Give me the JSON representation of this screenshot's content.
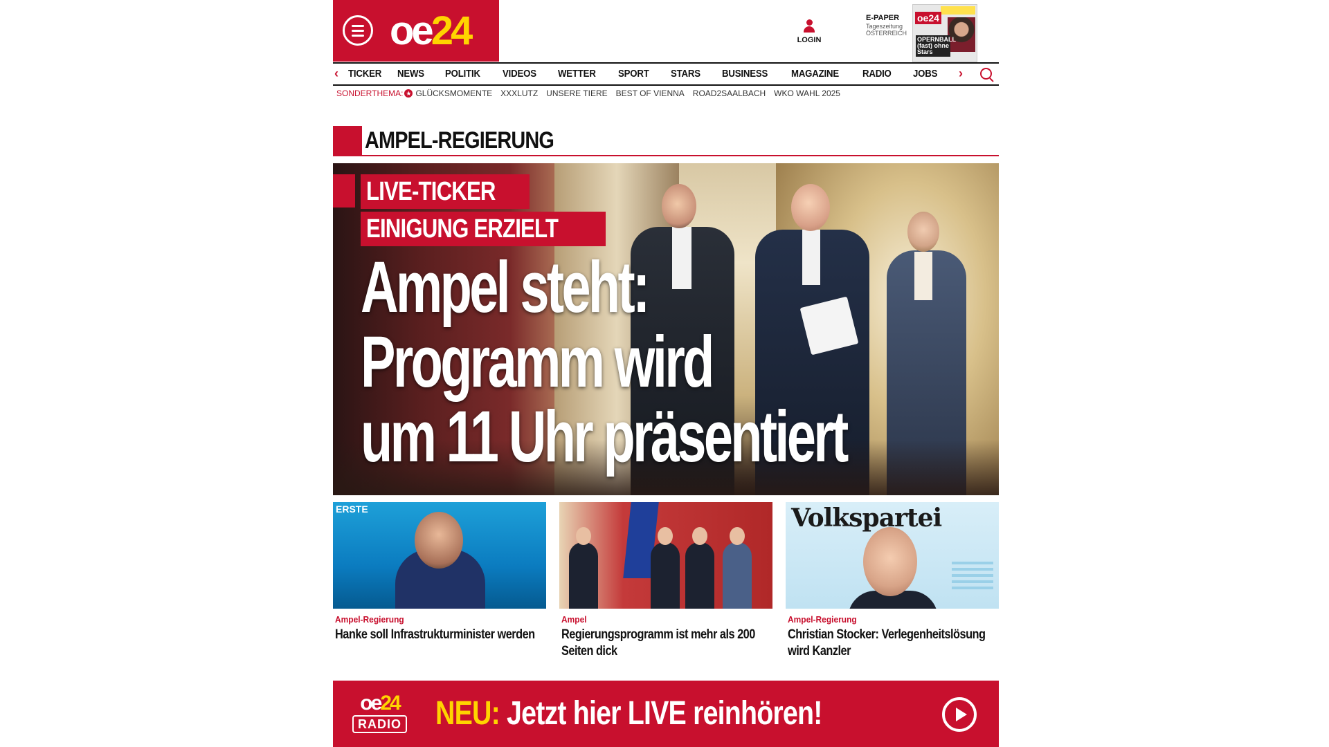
{
  "header": {
    "logo": {
      "part1": "oe",
      "part2": "24"
    },
    "login_label": "LOGIN",
    "epaper": {
      "title": "E-PAPER",
      "line1": "Tageszeitung",
      "line2": "ÖSTERREICH"
    },
    "cover_thumb": {
      "logo": "oe24",
      "headline": "OPERNBALL (fast) ohne Stars"
    }
  },
  "nav": {
    "items": [
      "TICKER",
      "NEWS",
      "POLITIK",
      "VIDEOS",
      "WETTER",
      "SPORT",
      "STARS",
      "BUSINESS",
      "MAGAZINE",
      "RADIO",
      "JOBS"
    ],
    "prev_icon": "chevron-left-icon",
    "next_icon": "chevron-right-icon",
    "search_icon": "search-icon"
  },
  "subnav": {
    "label": "SONDERTHEMA:",
    "items": [
      "GLÜCKSMOMENTE",
      "XXXLUTZ",
      "UNSERE TIERE",
      "BEST OF VIENNA",
      "ROAD2SAALBACH",
      "WKO WAHL 2025"
    ]
  },
  "section": {
    "title": "AMPEL-REGIERUNG"
  },
  "hero": {
    "kicker1": "LIVE-TICKER",
    "kicker2": "EINIGUNG ERZIELT",
    "headline_lines": [
      "Ampel steht:",
      "Programm wird",
      "um 11 Uhr präsentiert"
    ]
  },
  "cards": [
    {
      "category": "Ampel-Regierung",
      "title": "Hanke soll Infrastrukturminister werden",
      "image_text": "ERSTE"
    },
    {
      "category": "Ampel",
      "title": "Regierungsprogramm ist mehr als 200 Seiten dick"
    },
    {
      "category": "Ampel-Regierung",
      "title": "Christian Stocker: Verlegenheitslösung wird Kanzler",
      "image_text": "Volkspartei"
    }
  ],
  "radio_banner": {
    "logo_top_1": "oe",
    "logo_top_2": "24",
    "logo_bottom": "RADIO",
    "prefix": "NEU:",
    "message": "Jetzt hier LIVE reinhören!",
    "play_icon": "play-icon"
  },
  "colors": {
    "brand_red": "#c8102e",
    "brand_yellow": "#ffd400"
  }
}
